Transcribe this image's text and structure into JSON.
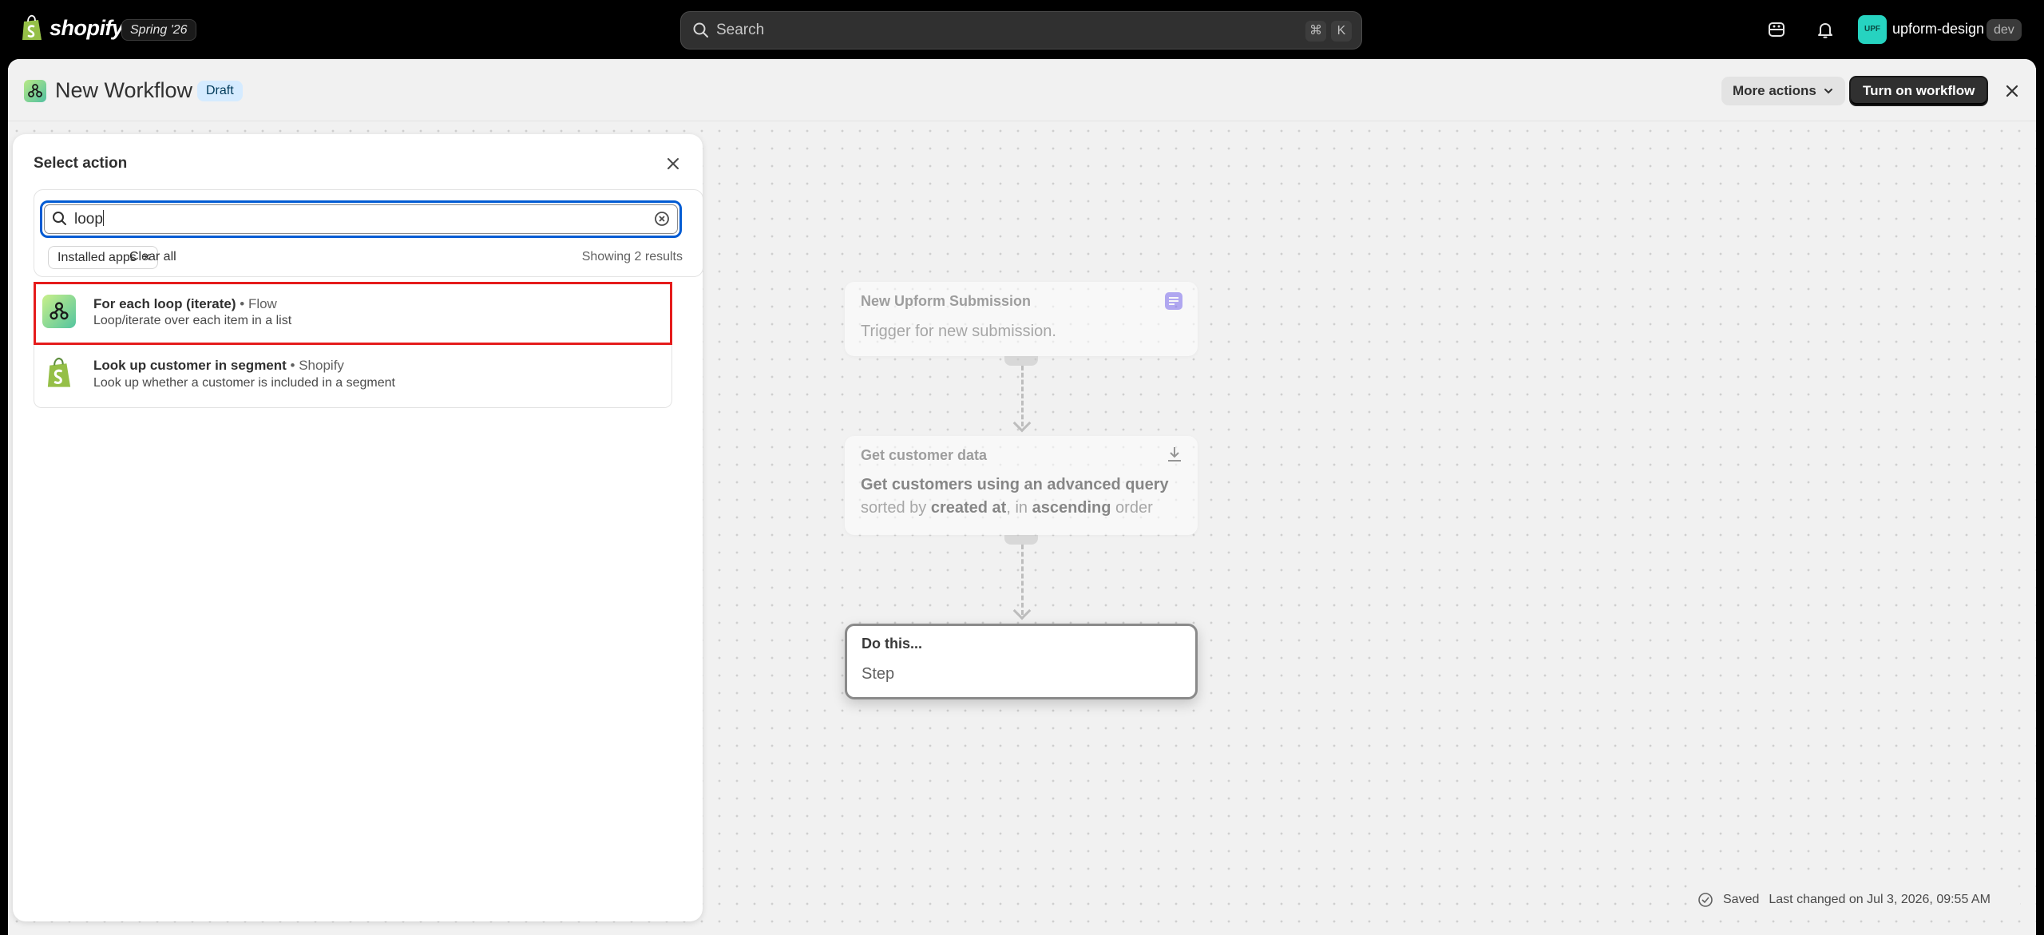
{
  "topbar": {
    "logo_text": "shopify",
    "edition": "Spring '26",
    "search_placeholder": "Search",
    "shortcut_cmd": "⌘",
    "shortcut_key": "K",
    "avatar_initials": "UPF",
    "store_name": "upform-design",
    "store_tag": "dev"
  },
  "header": {
    "title": "New Workflow",
    "status_badge": "Draft",
    "more_actions_label": "More actions",
    "turn_on_label": "Turn on workflow"
  },
  "panel": {
    "title": "Select action",
    "search_value": "loop",
    "filter_chip": "Installed apps",
    "clear_all": "Clear all",
    "results_count": "Showing 2 results",
    "results": [
      {
        "title": "For each loop (iterate)",
        "source": "• Flow",
        "description": "Loop/iterate over each item in a list",
        "icon": "flow-app-icon"
      },
      {
        "title": "Look up customer in segment",
        "source": "• Shopify",
        "description": "Look up whether a customer is included in a segment",
        "icon": "shopify-bag-icon"
      }
    ]
  },
  "workflow": {
    "nodes": [
      {
        "label": "New Upform Submission",
        "body": "Trigger for new submission.",
        "icon": "form-icon"
      },
      {
        "label": "Get customer data",
        "body_line1": "Get customers using an advanced query",
        "body_line2_parts": [
          "sorted by ",
          "created at",
          ", in ",
          "ascending",
          " order"
        ],
        "icon": "download-icon"
      },
      {
        "label": "Do this...",
        "body": "Step"
      }
    ]
  },
  "status": {
    "saved_label": "Saved",
    "last_changed": "Last changed on Jul 3, 2026, 09:55 AM"
  },
  "colors": {
    "accent_focus": "#005bd3",
    "highlight_border": "#e51c1c",
    "draft_badge_bg": "#d5ebff",
    "primary_button": "#303030"
  }
}
